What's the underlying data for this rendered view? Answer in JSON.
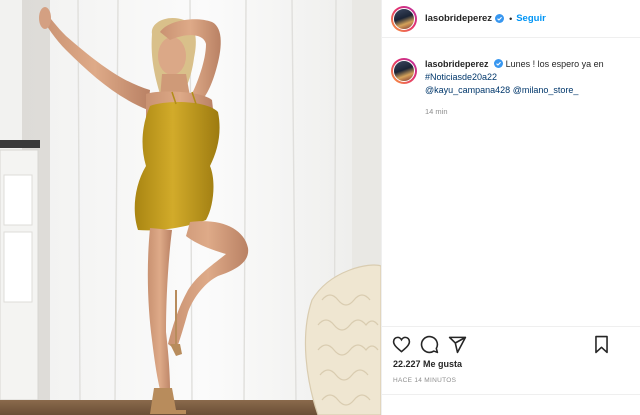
{
  "post": {
    "username": "lasobrideperez",
    "follow_label": "Seguir",
    "separator": "•"
  },
  "caption": {
    "username": "lasobrideperez",
    "text": "Lunes ! los espero ya en",
    "hashtag": "#Noticiasde20a22",
    "mention_1": "@kayu_campana428",
    "mention_2": "@milano_store_",
    "time": "14 min"
  },
  "stats": {
    "likes": "22.227 Me gusta",
    "posted_ago": "HACE 14 MINUTOS"
  },
  "icons": [
    "verified-badge-icon",
    "heart-icon",
    "comment-icon",
    "share-icon",
    "bookmark-icon"
  ],
  "colors": {
    "link_blue": "#0095f6",
    "tag_blue": "#00376b",
    "text": "#262626",
    "muted": "#8e8e8e",
    "dress": "#c8a01c"
  }
}
